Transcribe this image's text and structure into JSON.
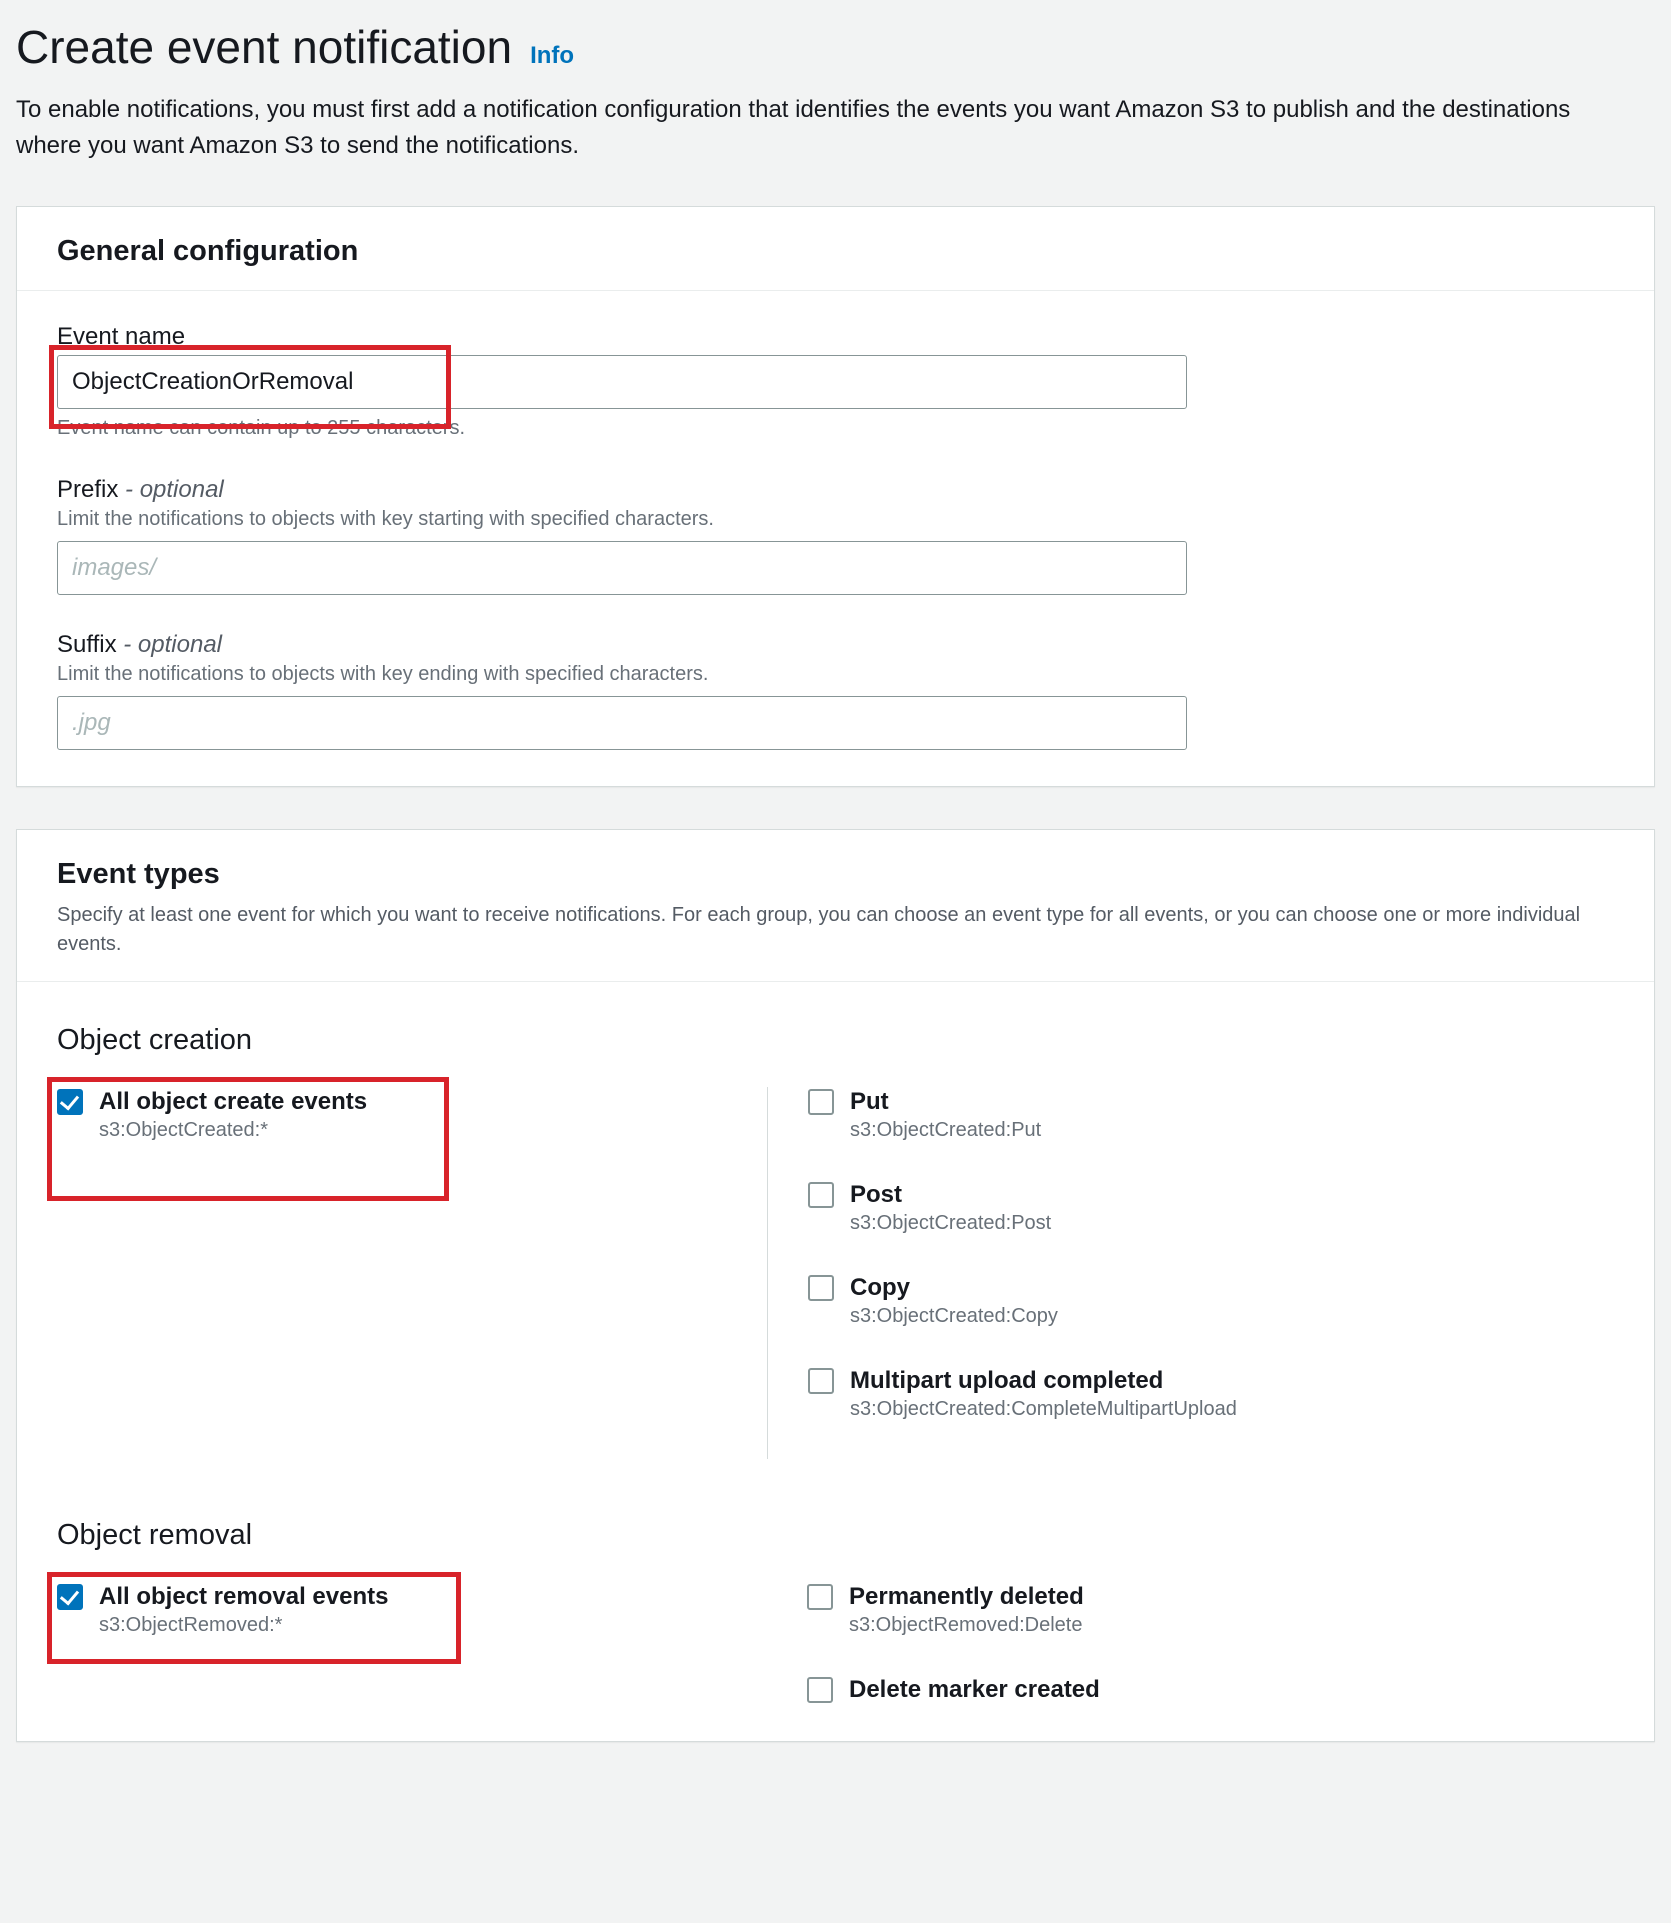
{
  "header": {
    "title": "Create event notification",
    "info_link": "Info",
    "description": "To enable notifications, you must first add a notification configuration that identifies the events you want Amazon S3 to publish and the destinations where you want Amazon S3 to send the notifications."
  },
  "general": {
    "panel_title": "General configuration",
    "event_name_label": "Event name",
    "event_name_value": "ObjectCreationOrRemoval",
    "event_name_hint": "Event name can contain up to 255 characters.",
    "prefix_label": "Prefix",
    "optional_text": "- optional",
    "prefix_sublabel": "Limit the notifications to objects with key starting with specified characters.",
    "prefix_placeholder": "images/",
    "suffix_label": "Suffix",
    "suffix_sublabel": "Limit the notifications to objects with key ending with specified characters.",
    "suffix_placeholder": ".jpg"
  },
  "event_types": {
    "panel_title": "Event types",
    "panel_desc": "Specify at least one event for which you want to receive notifications. For each group, you can choose an event type for all events, or you can choose one or more individual events.",
    "object_creation": {
      "title": "Object creation",
      "all_label": "All object create events",
      "all_sub": "s3:ObjectCreated:*",
      "items": [
        {
          "label": "Put",
          "sub": "s3:ObjectCreated:Put"
        },
        {
          "label": "Post",
          "sub": "s3:ObjectCreated:Post"
        },
        {
          "label": "Copy",
          "sub": "s3:ObjectCreated:Copy"
        },
        {
          "label": "Multipart upload completed",
          "sub": "s3:ObjectCreated:CompleteMultipartUpload"
        }
      ]
    },
    "object_removal": {
      "title": "Object removal",
      "all_label": "All object removal events",
      "all_sub": "s3:ObjectRemoved:*",
      "items": [
        {
          "label": "Permanently deleted",
          "sub": "s3:ObjectRemoved:Delete"
        },
        {
          "label": "Delete marker created",
          "sub": ""
        }
      ]
    }
  }
}
